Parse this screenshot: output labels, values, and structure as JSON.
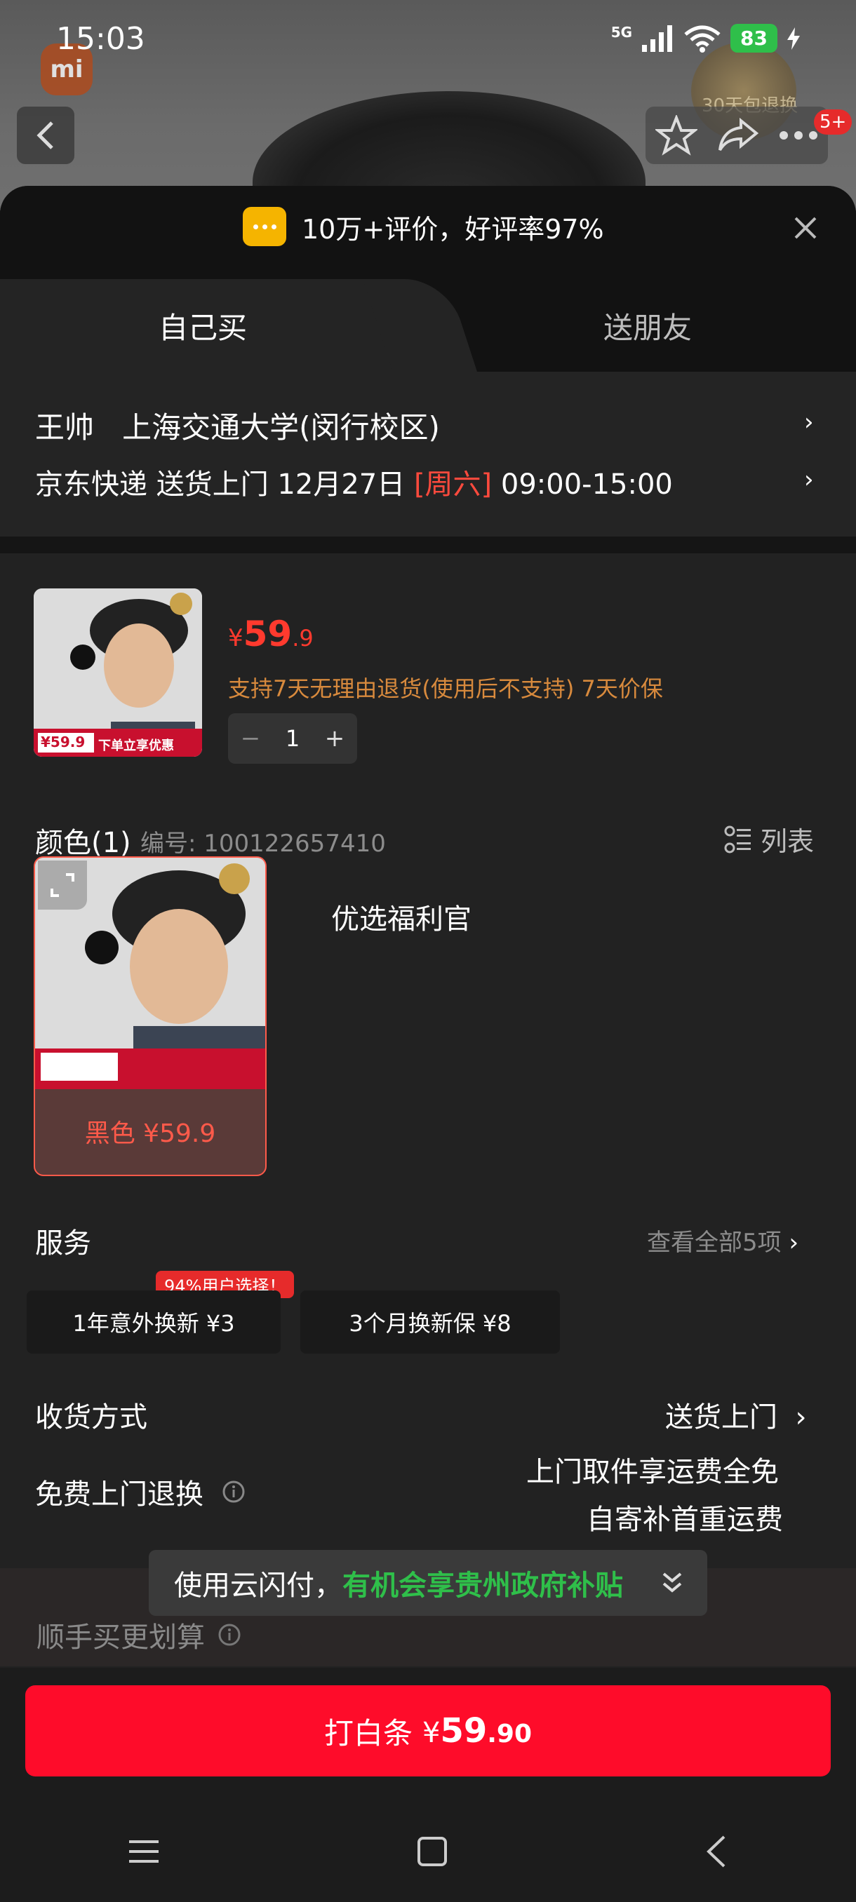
{
  "status": {
    "time": "15:03",
    "network": "5G",
    "battery": "83"
  },
  "header": {
    "badge_text": "30天包退换",
    "cart_count": "5+",
    "logo": "mi"
  },
  "sheet": {
    "rating_text": "10万+评价，好评率97%",
    "tabs": [
      {
        "label": "自己买"
      },
      {
        "label": "送朋友"
      }
    ],
    "address": {
      "name": "王帅",
      "location": "上海交通大学(闵行校区)",
      "delivery_prefix": "京东快递 送货上门 12月27日",
      "delivery_day": "[周六]",
      "delivery_time": "09:00-15:00"
    },
    "product": {
      "price_symbol": "¥",
      "price_int": "59",
      "price_dec": ".9",
      "policy": "支持7天无理由退货(使用后不支持) 7天价保",
      "quantity": "1",
      "thumb_price": "¥59.9",
      "thumb_banner": "下单立享优惠"
    },
    "color": {
      "title": "颜色(1)",
      "code": "编号: 100122657410",
      "list_label": "列表",
      "option_label": "黑色 ¥59.9",
      "side_label": "优选福利官"
    },
    "services": {
      "title": "服务",
      "more": "查看全部5项",
      "tag": "94%用户选择！",
      "items": [
        {
          "label": "1年意外换新 ¥3"
        },
        {
          "label": "3个月换新保 ¥8"
        }
      ]
    },
    "shipping": {
      "title": "收货方式",
      "value": "送货上门"
    },
    "returns": {
      "title": "免费上门退换",
      "line1": "上门取件享运费全免",
      "line2": "自寄补首重运费"
    },
    "bundle": {
      "title": "顺手买更划算"
    },
    "toast": {
      "prefix": "使用云闪付，",
      "highlight": "有机会享贵州政府补贴"
    },
    "pay": {
      "label": "打白条",
      "symbol": "¥",
      "amount": "59",
      "decimal": ".90"
    }
  },
  "colors": {
    "accent_red": "#fe0c2a",
    "price_red": "#ff3a2e",
    "green": "#2fbf4a",
    "orange": "#d88a3d"
  }
}
